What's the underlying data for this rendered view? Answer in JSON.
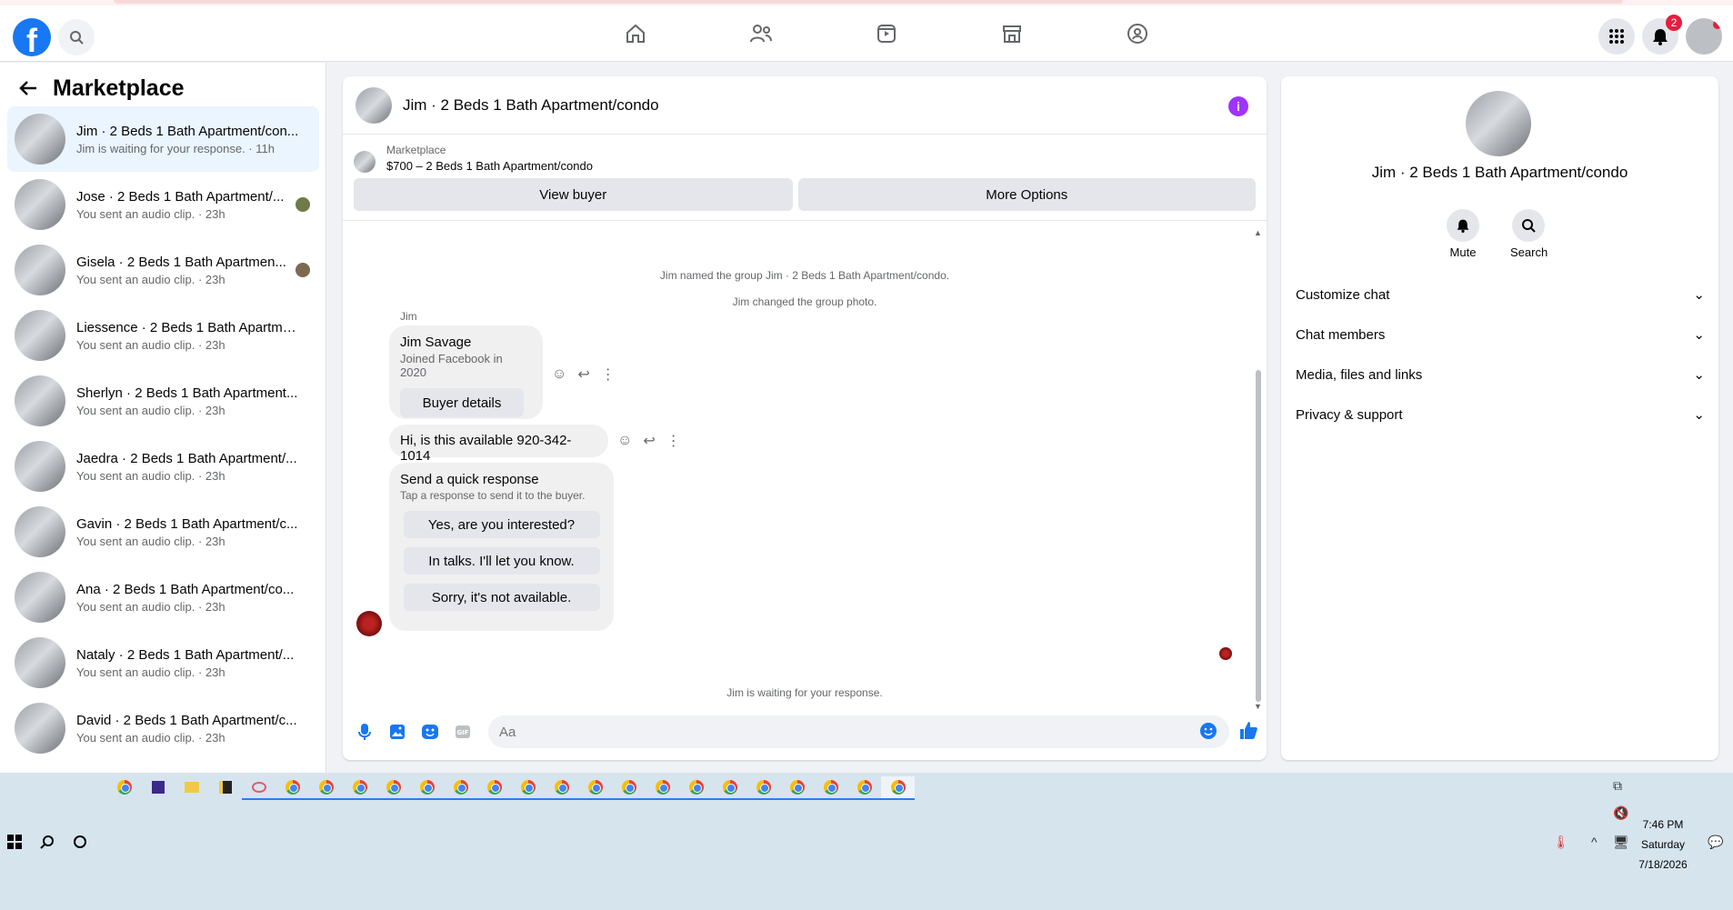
{
  "sidebar": {
    "title": "Marketplace",
    "conversations": [
      {
        "title": "Jim · 2 Beds 1 Bath Apartment/con...",
        "subtitle": "Jim is waiting for your response. · 11h"
      },
      {
        "title": "Jose · 2 Beds 1 Bath Apartment/...",
        "subtitle": "You sent an audio clip. · 23h"
      },
      {
        "title": "Gisela · 2 Beds 1 Bath Apartmen...",
        "subtitle": "You sent an audio clip. · 23h"
      },
      {
        "title": "Liessence · 2 Beds 1 Bath Apartme...",
        "subtitle": "You sent an audio clip. · 23h"
      },
      {
        "title": "Sherlyn · 2 Beds 1 Bath Apartment...",
        "subtitle": "You sent an audio clip. · 23h"
      },
      {
        "title": "Jaedra · 2 Beds 1 Bath Apartment/...",
        "subtitle": "You sent an audio clip. · 23h"
      },
      {
        "title": "Gavin · 2 Beds 1 Bath Apartment/c...",
        "subtitle": "You sent an audio clip. · 23h"
      },
      {
        "title": "Ana · 2 Beds 1 Bath Apartment/co...",
        "subtitle": "You sent an audio clip. · 23h"
      },
      {
        "title": "Nataly · 2 Beds 1 Bath Apartment/...",
        "subtitle": "You sent an audio clip. · 23h"
      },
      {
        "title": "David · 2 Beds 1 Bath Apartment/c...",
        "subtitle": "You sent an audio clip. · 23h"
      }
    ]
  },
  "header": {
    "notification_count": "2",
    "nav_icons": [
      "home-icon",
      "friends-icon",
      "watch-icon",
      "marketplace-icon",
      "groups-icon"
    ]
  },
  "chat": {
    "title": "Jim · 2 Beds 1 Bath Apartment/condo",
    "listing_source": "Marketplace",
    "listing_title": "$700 – 2 Beds 1 Bath Apartment/condo",
    "view_buyer_label": "View buyer",
    "more_options_label": "More Options",
    "system_messages": [
      "Jim named the group Jim · 2 Beds 1 Bath Apartment/condo.",
      "Jim changed the group photo."
    ],
    "sender_name": "Jim",
    "buyer_card": {
      "name": "Jim Savage",
      "joined": "Joined Facebook in 2020",
      "button_label": "Buyer details"
    },
    "message_text": "Hi, is this available 920-342-1014",
    "quick_response": {
      "title": "Send a quick response",
      "subtitle": "Tap a response to send it to the buyer.",
      "options": [
        "Yes, are you interested?",
        "In talks. I'll let you know.",
        "Sorry, it's not available."
      ]
    },
    "waiting_text": "Jim is waiting for your response.",
    "input_placeholder": "Aa"
  },
  "right_panel": {
    "title": "Jim · 2 Beds 1 Bath Apartment/condo",
    "mute_label": "Mute",
    "search_label": "Search",
    "sections": [
      "Customize chat",
      "Chat members",
      "Media, files and links",
      "Privacy & support"
    ]
  },
  "taskbar": {
    "time": "7:46 PM",
    "day": "Saturday",
    "date": "7/18/2026"
  },
  "colors": {
    "brand_blue": "#1877f2",
    "info_purple": "#a033ff",
    "badge_red": "#e41e3f"
  }
}
